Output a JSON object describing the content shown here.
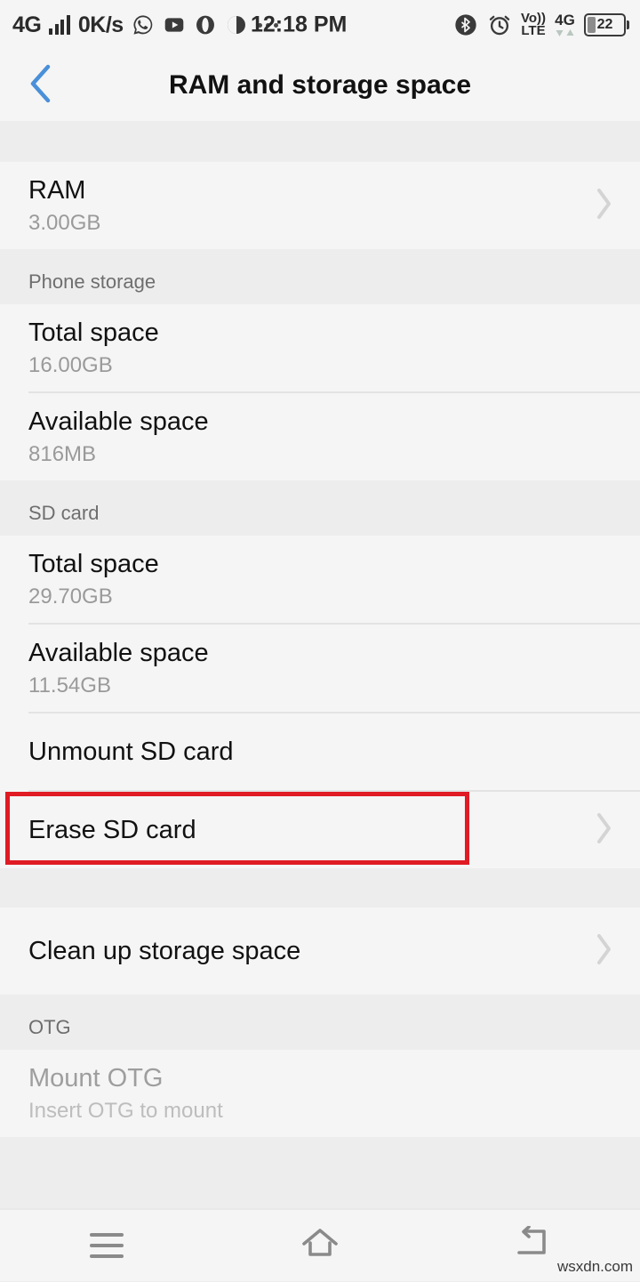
{
  "status_bar": {
    "network_type": "4G",
    "data_rate": "0K/s",
    "time": "12:18 PM",
    "icons_left": [
      "signal-bars-icon",
      "whatsapp-icon",
      "youtube-icon",
      "opera-icon",
      "clock-app-icon",
      "more-notifications-icon"
    ],
    "bluetooth": "bluetooth-icon",
    "alarm": "alarm-icon",
    "volte_top": "Vo))",
    "volte_bottom": "LTE",
    "network_label": "4G",
    "battery_level": "22",
    "battery_percent": 22
  },
  "app_bar": {
    "back_label": "back-chevron",
    "title": "RAM and storage space",
    "accent_color": "#4a90d9"
  },
  "sections": [
    {
      "header": null,
      "rows": [
        {
          "title": "RAM",
          "sub": "3.00GB",
          "chevron": true,
          "disabled": false
        }
      ]
    },
    {
      "header": "Phone storage",
      "rows": [
        {
          "title": "Total space",
          "sub": "16.00GB",
          "chevron": false,
          "disabled": false
        },
        {
          "title": "Available space",
          "sub": "816MB",
          "chevron": false,
          "disabled": false
        }
      ]
    },
    {
      "header": "SD card",
      "rows": [
        {
          "title": "Total space",
          "sub": "29.70GB",
          "chevron": false,
          "disabled": false
        },
        {
          "title": "Available space",
          "sub": "11.54GB",
          "chevron": false,
          "disabled": false
        },
        {
          "title": "Unmount SD card",
          "sub": null,
          "chevron": false,
          "disabled": false
        },
        {
          "title": "Erase SD card",
          "sub": null,
          "chevron": true,
          "disabled": false,
          "highlighted": true
        }
      ]
    },
    {
      "header": null,
      "rows": [
        {
          "title": "Clean up storage space",
          "sub": null,
          "chevron": true,
          "disabled": false
        }
      ]
    },
    {
      "header": "OTG",
      "rows": [
        {
          "title": "Mount OTG",
          "sub": "Insert OTG to mount",
          "chevron": false,
          "disabled": true
        }
      ]
    }
  ],
  "annotation": {
    "color": "#e01b24",
    "target": "Erase SD card"
  },
  "nav_bar": {
    "menu": "menu-icon",
    "home": "home-icon",
    "back": "back-icon"
  },
  "watermark": "wsxdn.com"
}
